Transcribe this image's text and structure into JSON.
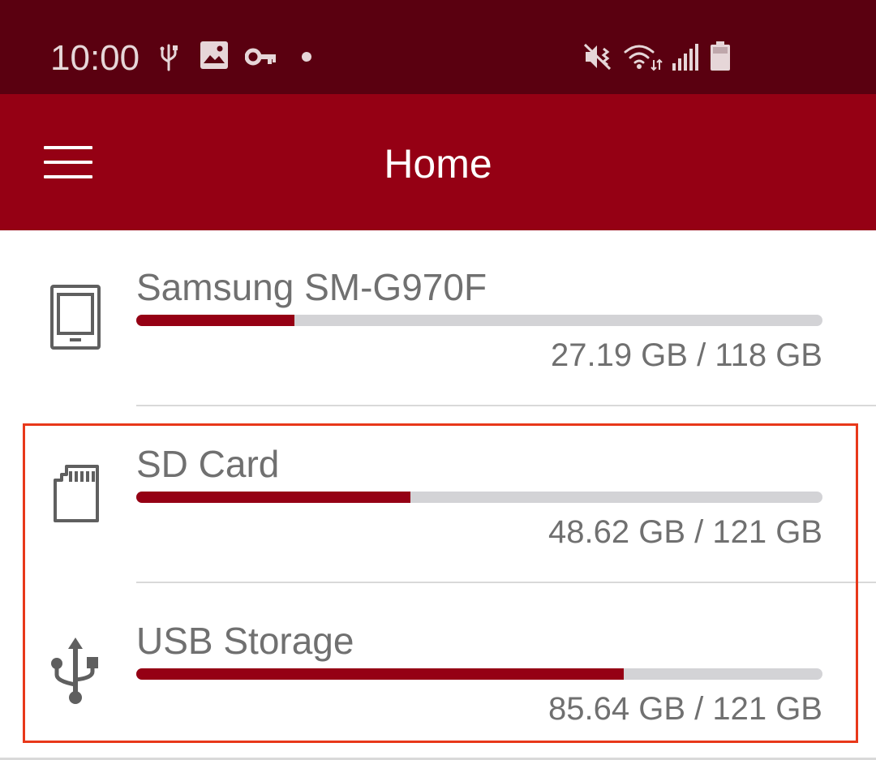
{
  "status_bar": {
    "time": "10:00",
    "left_icons": [
      "usb-icon",
      "image-icon",
      "key-icon",
      "dot-icon"
    ],
    "right_icons": [
      "vibrate-mute-icon",
      "wifi-icon",
      "signal-icon",
      "battery-icon"
    ]
  },
  "app_bar": {
    "title": "Home",
    "menu_icon": "hamburger-menu-icon",
    "color": "#950014"
  },
  "storage": [
    {
      "name": "Samsung SM-G970F",
      "icon": "tablet-icon",
      "size_text": "27.19 GB / 118 GB",
      "used_fraction": 0.23
    },
    {
      "name": "SD Card",
      "icon": "sd-card-icon",
      "size_text": "48.62 GB / 121 GB",
      "used_fraction": 0.4
    },
    {
      "name": "USB Storage",
      "icon": "usb-icon",
      "size_text": "85.64 GB / 121 GB",
      "used_fraction": 0.71
    }
  ],
  "colors": {
    "status_bar": "#5a0010",
    "accent": "#950014",
    "track": "#d3d3d6",
    "highlight": "#e8381a"
  }
}
